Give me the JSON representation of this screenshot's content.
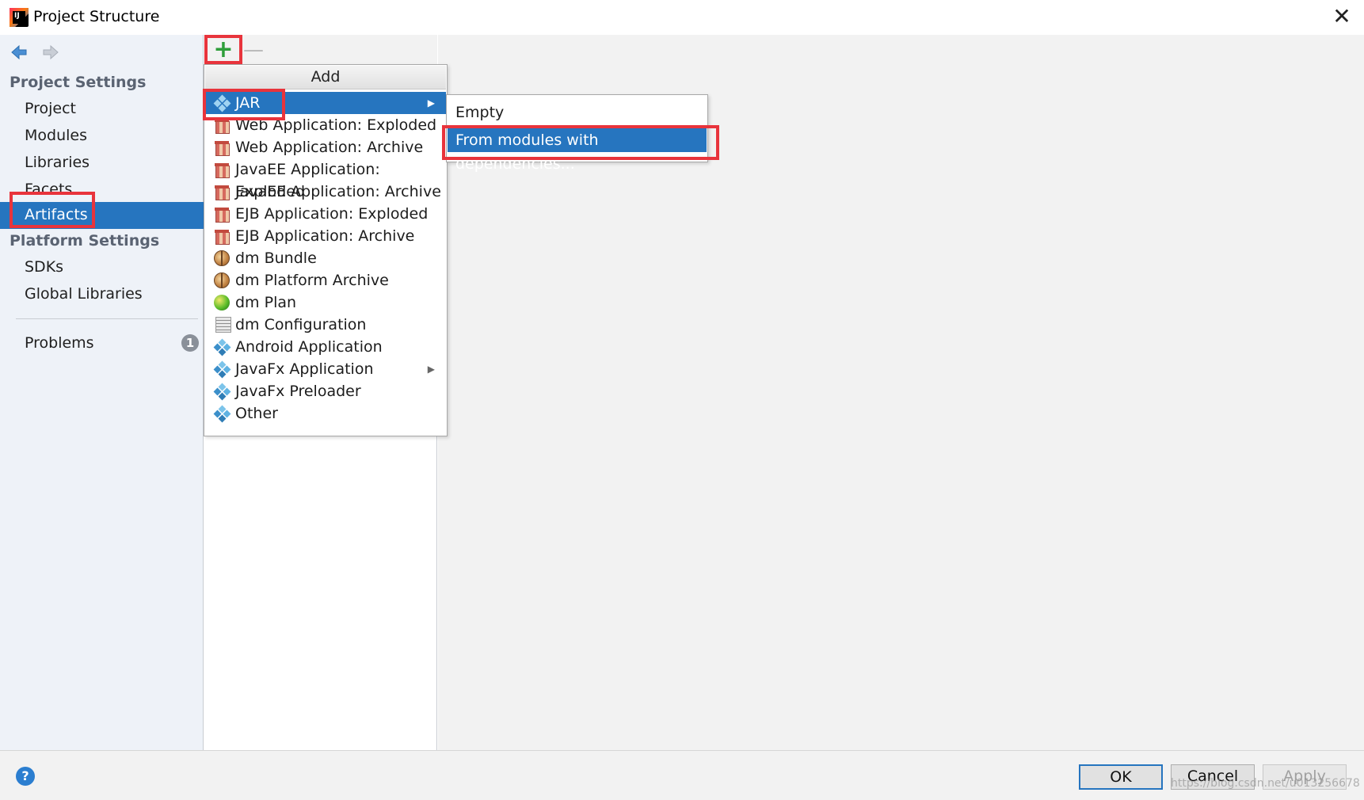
{
  "window": {
    "title": "Project Structure",
    "app_icon_text": "IJ"
  },
  "sidebar": {
    "project_settings_header": "Project Settings",
    "project_items": [
      {
        "label": "Project"
      },
      {
        "label": "Modules"
      },
      {
        "label": "Libraries"
      },
      {
        "label": "Facets"
      },
      {
        "label": "Artifacts",
        "selected": true
      }
    ],
    "platform_settings_header": "Platform Settings",
    "platform_items": [
      {
        "label": "SDKs"
      },
      {
        "label": "Global Libraries"
      }
    ],
    "problems": {
      "label": "Problems",
      "count": "1"
    }
  },
  "toolbar": {
    "add_symbol": "+",
    "remove_symbol": "—"
  },
  "add_menu": {
    "header": "Add",
    "items": [
      {
        "label": "JAR",
        "icon": "diamond-icon",
        "submenu": true,
        "selected": true
      },
      {
        "label": "Web Application: Exploded",
        "icon": "gift-icon"
      },
      {
        "label": "Web Application: Archive",
        "icon": "gift-icon"
      },
      {
        "label": "JavaEE Application: Exploded",
        "icon": "gift-icon"
      },
      {
        "label": "JavaEE Application: Archive",
        "icon": "gift-icon"
      },
      {
        "label": "EJB Application: Exploded",
        "icon": "gift-icon"
      },
      {
        "label": "EJB Application: Archive",
        "icon": "gift-icon"
      },
      {
        "label": "dm Bundle",
        "icon": "bundle-icon"
      },
      {
        "label": "dm Platform Archive",
        "icon": "bundle-icon"
      },
      {
        "label": "dm Plan",
        "icon": "plan-icon"
      },
      {
        "label": "dm Configuration",
        "icon": "document-icon"
      },
      {
        "label": "Android Application",
        "icon": "diamond-icon"
      },
      {
        "label": "JavaFx Application",
        "icon": "diamond-icon",
        "submenu": true
      },
      {
        "label": "JavaFx Preloader",
        "icon": "diamond-icon"
      },
      {
        "label": "Other",
        "icon": "diamond-icon"
      }
    ]
  },
  "jar_submenu": {
    "items": [
      {
        "label": "Empty"
      },
      {
        "label": "From modules with dependencies...",
        "selected": true
      }
    ]
  },
  "buttons": {
    "help": "?",
    "ok": "OK",
    "cancel": "Cancel",
    "apply": "Apply"
  },
  "watermark": "https://blog.csdn.net/u013256678",
  "colors": {
    "selection": "#2675bf",
    "highlight": "#e8343c",
    "add_green": "#2e9e3a"
  }
}
